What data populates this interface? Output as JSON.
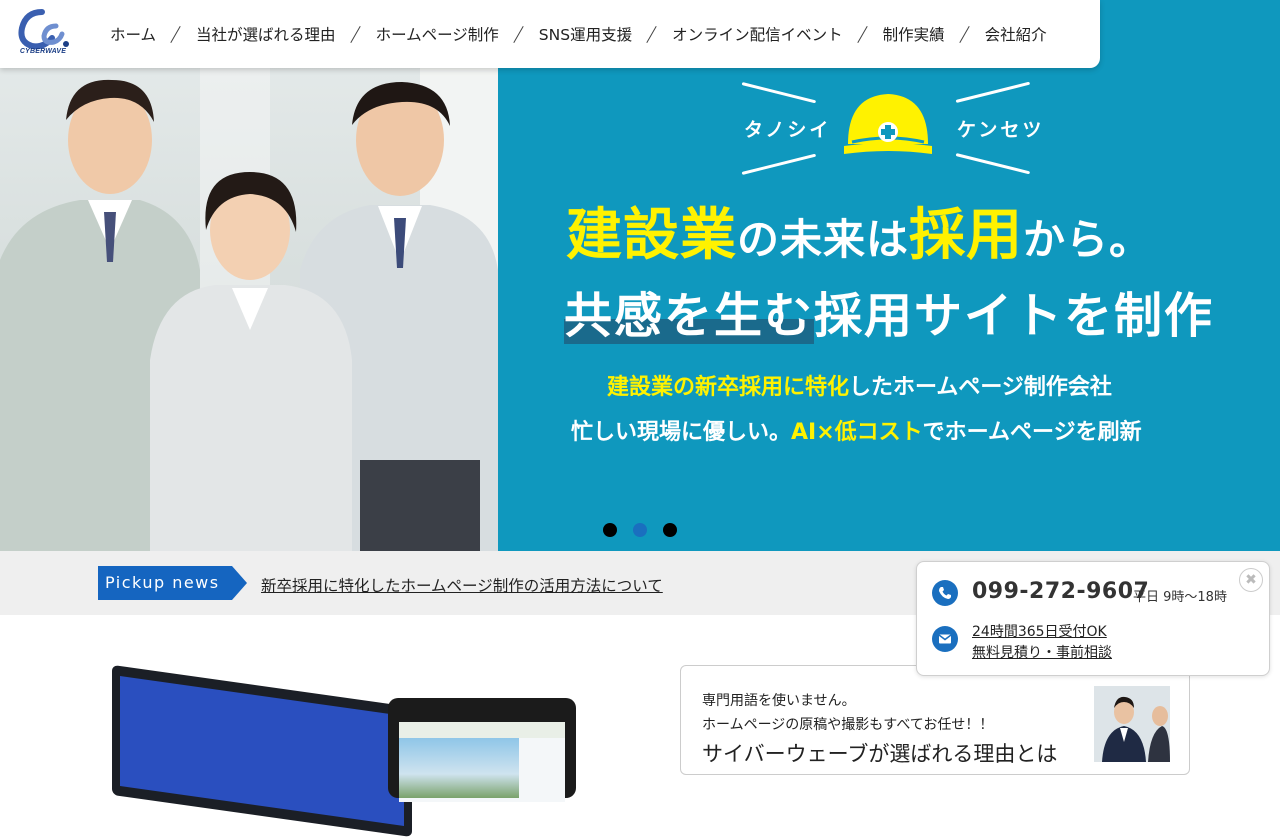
{
  "logo": {
    "text": "CYBERWAVE",
    "brand_color": "#1c3f86"
  },
  "nav": {
    "items": [
      "ホーム",
      "当社が選ばれる理由",
      "ホームページ制作",
      "SNS運用支援",
      "オンライン配信イベント",
      "制作実績",
      "会社紹介"
    ]
  },
  "hero": {
    "tagline_left": "タノシイ",
    "tagline_right": "ケンセツ",
    "headline_1": {
      "a": "建設業",
      "b": "の未来は",
      "c": "採用",
      "d": "から。"
    },
    "headline_2": {
      "a": "共感を生む",
      "b": "採用サイトを制作"
    },
    "sub_1": {
      "a": "建設業の新卒採用に特化",
      "b": "したホームページ制作会社"
    },
    "sub_2": {
      "a": "忙しい現場に優しい。",
      "b": "AI×低コスト",
      "c": "でホームページを刷新"
    },
    "slide_count": 3,
    "active_slide": 2,
    "bg_color": "#0f98be",
    "highlight_color": "#fff200"
  },
  "pickup": {
    "tag": "Pickup news",
    "link": "新卒採用に特化したホームページ制作の活用方法について"
  },
  "contact": {
    "phone": "099-272-9607",
    "hours": "平日 9時〜18時",
    "line_1": "24時間365日受付OK",
    "line_2": "無料見積り・事前相談",
    "close_label": "✖",
    "phone_icon": "phone-icon",
    "mail_icon": "mail-icon"
  },
  "reason": {
    "line_1": "専門用語を使いません。",
    "line_2": "ホームページの原稿や撮影もすべてお任せ！！",
    "title": "サイバーウェーブが選ばれる理由とは"
  },
  "colors": {
    "accent": "#1a6fbf",
    "pickup_tag": "#1565c0"
  }
}
